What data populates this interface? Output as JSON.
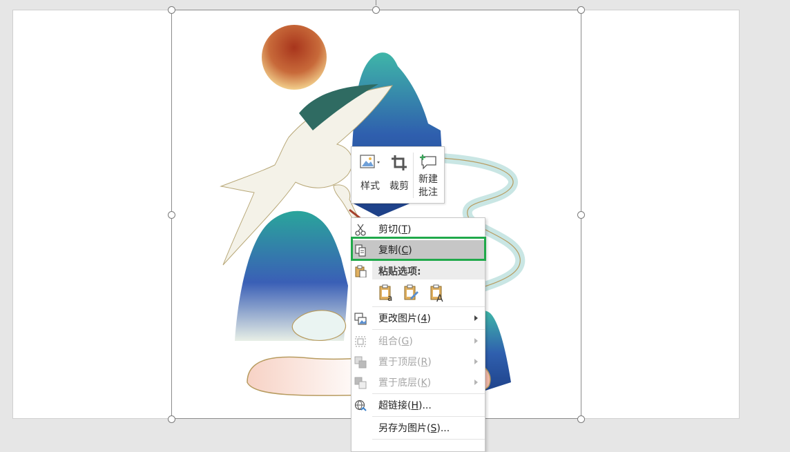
{
  "mini_toolbar": {
    "style_label": "样式",
    "crop_label": "裁剪",
    "comment_line1": "新建",
    "comment_line2": "批注"
  },
  "context_menu": {
    "cut": {
      "text": "剪切(",
      "key": "T",
      "suffix": ")"
    },
    "copy": {
      "text": "复制(",
      "key": "C",
      "suffix": ")"
    },
    "paste_options_label": "粘贴选项:",
    "change_picture": {
      "text": "更改图片(",
      "key": "4",
      "suffix": ")"
    },
    "group": {
      "text": "组合(",
      "key": "G",
      "suffix": ")"
    },
    "bring_to_front": {
      "text": "置于顶层(",
      "key": "R",
      "suffix": ")"
    },
    "send_to_back": {
      "text": "置于底层(",
      "key": "K",
      "suffix": ")"
    },
    "hyperlink": {
      "text": "超链接(",
      "key": "H",
      "suffix": ")..."
    },
    "save_as_picture": {
      "text": "另存为图片(",
      "key": "S",
      "suffix": ")..."
    }
  },
  "colors": {
    "highlight_border": "#20a94a",
    "menu_highlight": "#c6c6c6",
    "disabled_text": "#a6a6a6"
  }
}
